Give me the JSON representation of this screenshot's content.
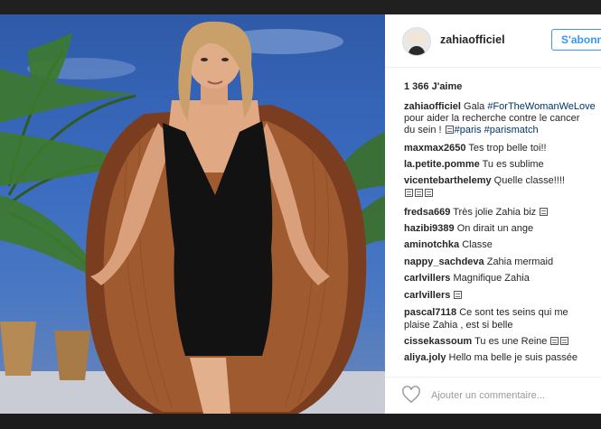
{
  "post": {
    "username": "zahiaofficiel",
    "follow_label": "S'abonner",
    "likes": "1 366 J'aime",
    "caption": {
      "user": "zahiaofficiel",
      "line1": "Gala ",
      "tag1": "#ForTheWomanWeLove",
      "line2": "pour aider la recherche contre le cancer",
      "line3": "du sein ! ",
      "tag2": "#paris",
      "tag3": "#parismatch"
    },
    "comments": [
      {
        "user": "maxmax2650",
        "text": "Tes trop belle toi!!"
      },
      {
        "user": "la.petite.pomme",
        "text": "Tu es sublime"
      },
      {
        "user": "vicentebarthelemy",
        "text": "Quelle classe!!!!"
      },
      {
        "user": "fredsa669",
        "text": "Très jolie Zahia biz"
      },
      {
        "user": "hazibi9389",
        "text": "On dirait un ange"
      },
      {
        "user": "aminotchka",
        "text": "Classe"
      },
      {
        "user": "nappy_sachdeva",
        "text": "Zahia mermaid"
      },
      {
        "user": "carlvillers",
        "text": "Magnifique Zahia"
      },
      {
        "user": "carlvillers",
        "text": ""
      },
      {
        "user": "pascal7118",
        "text": "Ce sont tes seins qui me"
      },
      {
        "user": "",
        "text": "plaise Zahia , est si belle"
      },
      {
        "user": "cissekassoum",
        "text": "Tu es une Reine"
      },
      {
        "user": "aliya.joly",
        "text": "Hello ma belle je suis passée"
      }
    ],
    "add_comment_placeholder": "Ajouter un commentaire...",
    "colors": {
      "accent": "#3897f0",
      "hashtag": "#003569",
      "text": "#262626"
    },
    "icons": [
      "heart-icon",
      "avatar"
    ]
  }
}
